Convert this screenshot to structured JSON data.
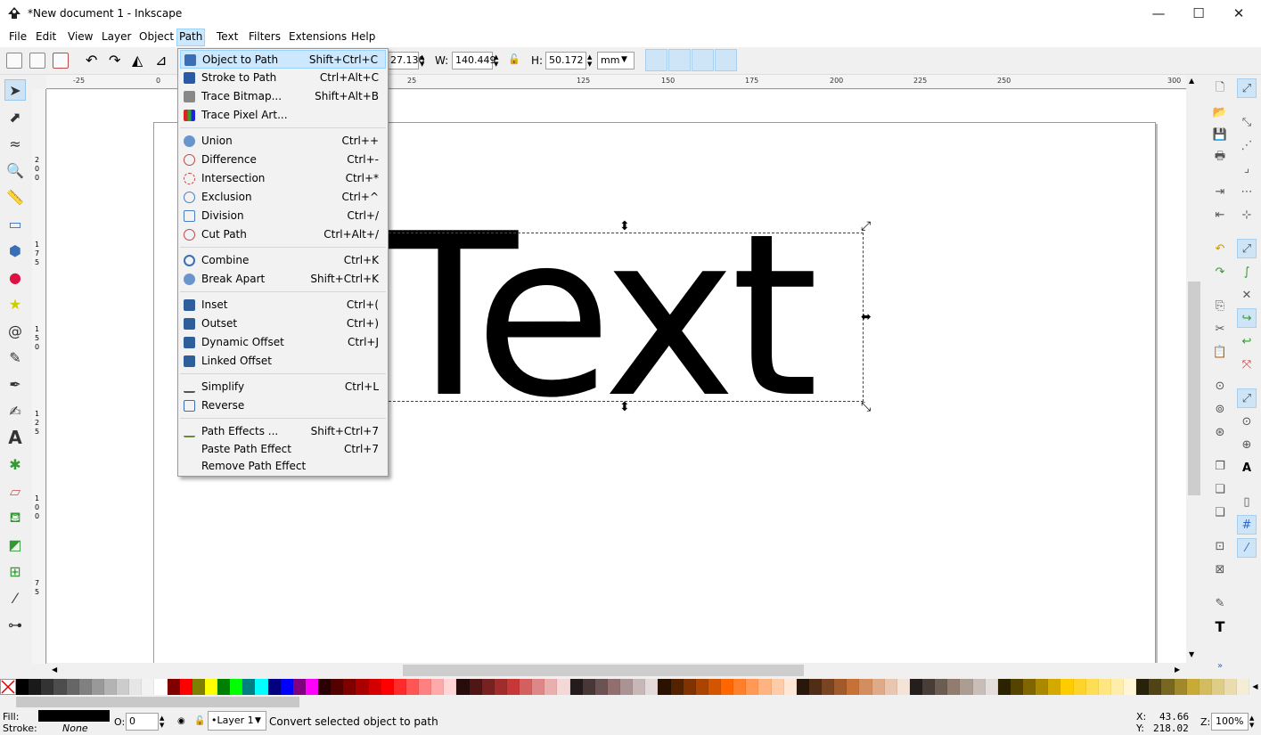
{
  "window": {
    "title": "*New document 1 - Inkscape",
    "minimize": "—",
    "maximize": "☐",
    "close": "✕"
  },
  "menubar": [
    "File",
    "Edit",
    "View",
    "Layer",
    "Object",
    "Path",
    "Text",
    "Filters",
    "Extensions",
    "Help"
  ],
  "toolbar": {
    "x_value": "27.130",
    "w_label": "W:",
    "w_value": "140.449",
    "h_label": "H:",
    "h_value": "50.172",
    "unit": "mm"
  },
  "ruler_h": [
    "-25",
    "0",
    "25",
    "125",
    "150",
    "175",
    "200",
    "225",
    "250",
    "300"
  ],
  "ruler_v": [
    "2 0 0",
    "1 7 5",
    "1 5 0",
    "1 2 5",
    "1 0 0",
    "7 5"
  ],
  "canvas_text": "Text",
  "path_menu": {
    "groups": [
      [
        {
          "label": "Object to Path",
          "shortcut": "Shift+Ctrl+C",
          "highlighted": true,
          "icon_color": "#3a6fb7"
        },
        {
          "label": "Stroke to Path",
          "shortcut": "Ctrl+Alt+C",
          "icon_color": "#2a5aa5"
        },
        {
          "label": "Trace Bitmap...",
          "shortcut": "Shift+Alt+B",
          "icon_color": "#666666"
        },
        {
          "label": "Trace Pixel Art...",
          "shortcut": "",
          "icon_color": "#d62a2a"
        }
      ],
      [
        {
          "label": "Union",
          "shortcut": "Ctrl++",
          "icon_color": "#4a7ec2"
        },
        {
          "label": "Difference",
          "shortcut": "Ctrl+-",
          "icon_color": "#c04848"
        },
        {
          "label": "Intersection",
          "shortcut": "Ctrl+*",
          "icon_color": "#c04848"
        },
        {
          "label": "Exclusion",
          "shortcut": "Ctrl+^",
          "icon_color": "#4a7ec2"
        },
        {
          "label": "Division",
          "shortcut": "Ctrl+/",
          "icon_color": "#4a7ec2"
        },
        {
          "label": "Cut Path",
          "shortcut": "Ctrl+Alt+/",
          "icon_color": "#c04848"
        }
      ],
      [
        {
          "label": "Combine",
          "shortcut": "Ctrl+K",
          "icon_color": "#3a6fb7"
        },
        {
          "label": "Break Apart",
          "shortcut": "Shift+Ctrl+K",
          "icon_color": "#3a6fb7"
        }
      ],
      [
        {
          "label": "Inset",
          "shortcut": "Ctrl+(",
          "icon_color": "#2e5f9a"
        },
        {
          "label": "Outset",
          "shortcut": "Ctrl+)",
          "icon_color": "#2e5f9a"
        },
        {
          "label": "Dynamic Offset",
          "shortcut": "Ctrl+J",
          "icon_color": "#2e5f9a"
        },
        {
          "label": "Linked Offset",
          "shortcut": "",
          "icon_color": "#2e5f9a"
        }
      ],
      [
        {
          "label": "Simplify",
          "shortcut": "Ctrl+L",
          "icon_color": "#555555"
        },
        {
          "label": "Reverse",
          "shortcut": "",
          "icon_color": "#3a6fb7"
        }
      ],
      [
        {
          "label": "Path Effects ...",
          "shortcut": "Shift+Ctrl+7",
          "icon_color": "#6a8a3a"
        },
        {
          "label": "Paste Path Effect",
          "shortcut": "Ctrl+7",
          "icon_color": ""
        },
        {
          "label": "Remove Path Effect",
          "shortcut": "",
          "icon_color": ""
        }
      ]
    ]
  },
  "status": {
    "fill_label": "Fill:",
    "stroke_label": "Stroke:",
    "stroke_value": "None",
    "opacity_label": "O:",
    "opacity_value": "0",
    "layer": "•Layer 1",
    "message": "Convert selected object to path",
    "x_label": "X:",
    "x_value": "43.66",
    "y_label": "Y:",
    "y_value": "218.02",
    "zoom_label": "Z:",
    "zoom_value": "100%"
  },
  "palette": [
    "#000000",
    "#1a1a1a",
    "#333333",
    "#4d4d4d",
    "#666666",
    "#808080",
    "#999999",
    "#b3b3b3",
    "#cccccc",
    "#e6e6e6",
    "#f2f2f2",
    "#ffffff",
    "#800000",
    "#ff0000",
    "#808000",
    "#ffff00",
    "#008000",
    "#00ff00",
    "#008080",
    "#00ffff",
    "#000080",
    "#0000ff",
    "#800080",
    "#ff00ff",
    "#2b0000",
    "#550000",
    "#800000",
    "#aa0000",
    "#d40000",
    "#ff0000",
    "#ff2a2a",
    "#ff5555",
    "#ff8080",
    "#ffaaaa",
    "#ffd5d5",
    "#280b0b",
    "#501616",
    "#782121",
    "#a02c2c",
    "#c83737",
    "#d35f5f",
    "#de8787",
    "#e9afaf",
    "#f4d7d7",
    "#241c1c",
    "#483737",
    "#6c5353",
    "#916f6f",
    "#ac9393",
    "#c8b7b7",
    "#e3dbdb",
    "#2b1100",
    "#552200",
    "#803300",
    "#aa4400",
    "#d45500",
    "#ff6600",
    "#ff7f2a",
    "#ff9955",
    "#ffb380",
    "#ffccaa",
    "#ffe6d5",
    "#28170b",
    "#502d16",
    "#784421",
    "#a05a2c",
    "#c87137",
    "#d38d5f",
    "#deaa87",
    "#e9c6af",
    "#f4e3d7",
    "#241f1c",
    "#483e37",
    "#6c5d53",
    "#917c6f",
    "#ac9d93",
    "#c8beb7",
    "#e3dedb",
    "#2b2200",
    "#554400",
    "#806600",
    "#aa8800",
    "#d4aa00",
    "#ffcc00",
    "#ffd42a",
    "#ffdd55",
    "#ffe680",
    "#ffeeaa",
    "#fff6d5",
    "#28220b",
    "#504416",
    "#786721",
    "#a0892c",
    "#c8ab37",
    "#d3bc5f",
    "#decd87",
    "#e9ddaf",
    "#f4eed7"
  ],
  "colors": {
    "accent": "#cce8ff",
    "accent_border": "#99d1ff",
    "menu_bg": "#f2f2f2"
  }
}
